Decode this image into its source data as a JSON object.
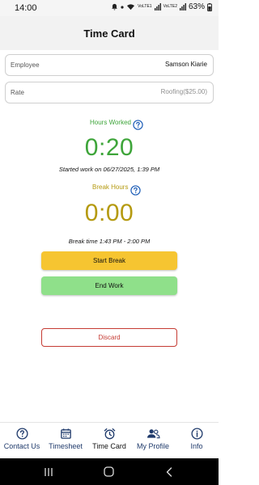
{
  "status_bar": {
    "time": "14:00",
    "battery": "63%",
    "network_1": "VoLTE1",
    "network_2": "VoLTE2"
  },
  "header": {
    "title": "Time Card"
  },
  "fields": {
    "employee": {
      "label": "Employee",
      "value": "Samson Kiarie"
    },
    "rate": {
      "label": "Rate",
      "value": "Roofing($25.00)"
    }
  },
  "hours_worked": {
    "label": "Hours Worked",
    "time": "0:20",
    "caption": "Started work on 06/27/2025, 1:39 PM",
    "color": "#3ea53a"
  },
  "break_hours": {
    "label": "Break Hours",
    "time": "0:00",
    "caption": "Break time 1:43 PM - 2:00 PM",
    "color": "#b59a10"
  },
  "buttons": {
    "start_break": "Start Break",
    "end_work": "End Work",
    "discard": "Discard"
  },
  "bottom_nav": [
    {
      "label": "Contact Us",
      "icon": "question-circle-icon"
    },
    {
      "label": "Timesheet",
      "icon": "calendar-icon"
    },
    {
      "label": "Time Card",
      "icon": "alarm-clock-icon",
      "active": true
    },
    {
      "label": "My Profile",
      "icon": "people-icon"
    },
    {
      "label": "Info",
      "icon": "info-circle-icon"
    }
  ],
  "colors": {
    "accent_blue": "#1f5fb8",
    "nav_blue": "#1f3a6b",
    "start_break": "#f6c531",
    "end_work": "#8fe08a",
    "discard": "#c53b33"
  }
}
